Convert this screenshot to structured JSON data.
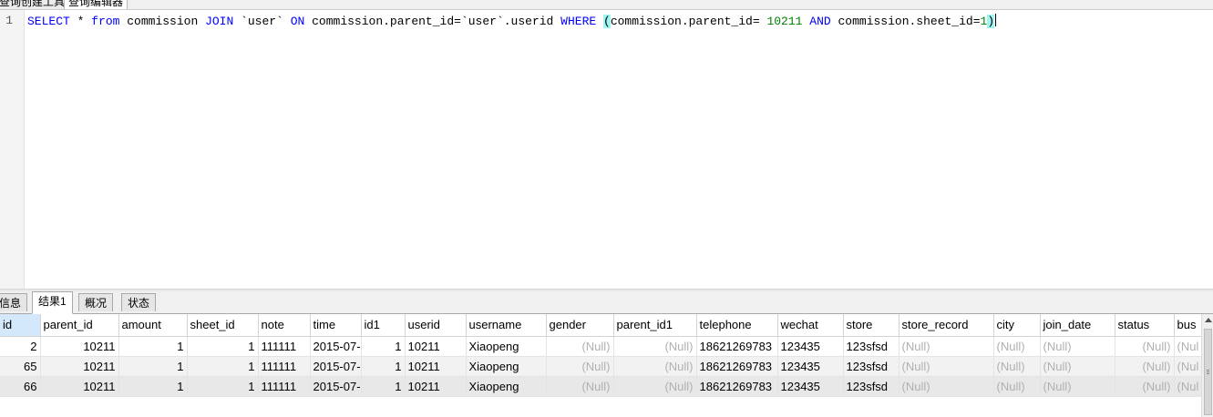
{
  "top_tabs": [
    {
      "label": "查询创建工具",
      "active": false
    },
    {
      "label": "查询编辑器",
      "active": true
    }
  ],
  "editor": {
    "line_number": "1",
    "tokens": [
      {
        "t": "SELECT",
        "c": "kw"
      },
      {
        "t": " * ",
        "c": ""
      },
      {
        "t": "from",
        "c": "kw"
      },
      {
        "t": " commission ",
        "c": ""
      },
      {
        "t": "JOIN",
        "c": "kw"
      },
      {
        "t": " `user` ",
        "c": ""
      },
      {
        "t": "ON",
        "c": "kw"
      },
      {
        "t": " commission.parent_id=`user`.userid ",
        "c": ""
      },
      {
        "t": "WHERE",
        "c": "kw"
      },
      {
        "t": " ",
        "c": ""
      },
      {
        "t": "(",
        "c": "paren-hl"
      },
      {
        "t": "commission.parent_id= ",
        "c": ""
      },
      {
        "t": "10211",
        "c": "num"
      },
      {
        "t": " ",
        "c": ""
      },
      {
        "t": "AND",
        "c": "kw"
      },
      {
        "t": " commission.sheet_id=",
        "c": ""
      },
      {
        "t": "1",
        "c": "num"
      },
      {
        "t": ")",
        "c": "paren-hl"
      }
    ]
  },
  "result_tabs": [
    {
      "label": "信息",
      "active": false
    },
    {
      "label": "结果1",
      "active": true
    },
    {
      "label": "概况",
      "active": false
    },
    {
      "label": "状态",
      "active": false
    }
  ],
  "grid": {
    "columns": [
      "id",
      "parent_id",
      "amount",
      "sheet_id",
      "note",
      "time",
      "id1",
      "userid",
      "username",
      "gender",
      "parent_id1",
      "telephone",
      "wechat",
      "store",
      "store_record",
      "city",
      "join_date",
      "status",
      "bus"
    ],
    "rows": [
      [
        "2",
        "10211",
        "1",
        "1",
        "111111",
        "2015-07-",
        "1",
        "10211",
        "Xiaopeng",
        "(Null)",
        "(Null)",
        "18621269783",
        "123435",
        "123sfsd",
        "(Null)",
        "(Null)",
        "(Null)",
        "(Null)",
        "(Nul"
      ],
      [
        "65",
        "10211",
        "1",
        "1",
        "111111",
        "2015-07-",
        "1",
        "10211",
        "Xiaopeng",
        "(Null)",
        "(Null)",
        "18621269783",
        "123435",
        "123sfsd",
        "(Null)",
        "(Null)",
        "(Null)",
        "(Null)",
        "(Nul"
      ],
      [
        "66",
        "10211",
        "1",
        "1",
        "111111",
        "2015-07-",
        "1",
        "10211",
        "Xiaopeng",
        "(Null)",
        "(Null)",
        "18621269783",
        "123435",
        "123sfsd",
        "(Null)",
        "(Null)",
        "(Null)",
        "(Null)",
        "(Nul"
      ]
    ]
  }
}
